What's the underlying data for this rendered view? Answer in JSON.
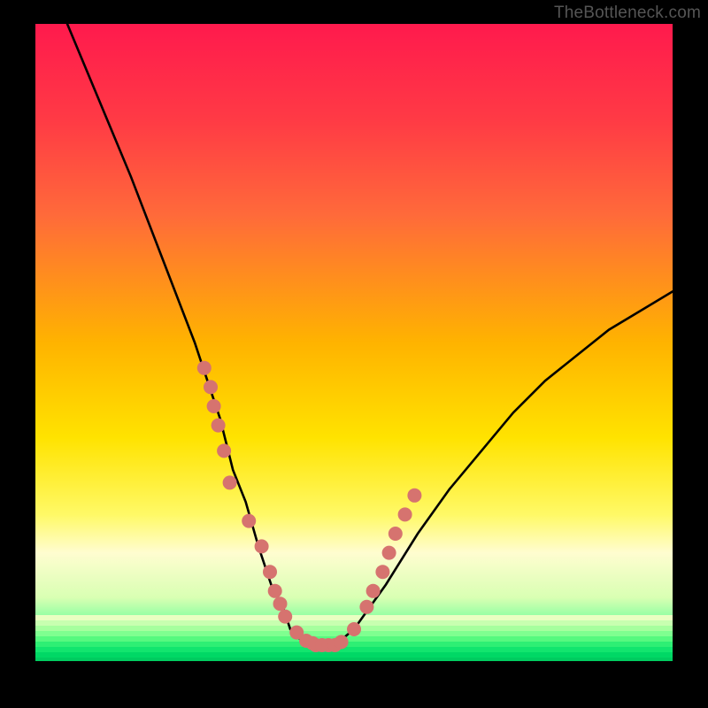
{
  "watermark": "TheBottleneck.com",
  "colors": {
    "background": "#000000",
    "curve": "#000000",
    "dot_fill": "#d6736f",
    "dot_stroke": "#b94f4c",
    "gradient_top": "#ff1a4d",
    "gradient_bottom": "#00d865"
  },
  "chart_data": {
    "type": "line",
    "title": "",
    "xlabel": "",
    "ylabel": "",
    "xlim": [
      0,
      100
    ],
    "ylim": [
      0,
      100
    ],
    "grid": false,
    "series": [
      {
        "name": "bottleneck-curve",
        "x": [
          5,
          10,
          15,
          20,
          25,
          26,
          27,
          28,
          29,
          30,
          31,
          33,
          35,
          37,
          39,
          40,
          41,
          42,
          43,
          44,
          45,
          46,
          47,
          50,
          55,
          60,
          65,
          70,
          75,
          80,
          85,
          90,
          95,
          100
        ],
        "y": [
          100,
          88,
          76,
          63,
          50,
          47,
          44,
          41,
          38,
          34,
          30,
          25,
          18,
          12,
          8,
          5,
          4,
          3,
          2.5,
          2.5,
          2,
          2,
          2.5,
          5,
          12,
          20,
          27,
          33,
          39,
          44,
          48,
          52,
          55,
          58
        ]
      }
    ],
    "markers": {
      "name": "highlight-dots",
      "x": [
        26.5,
        27.5,
        28.0,
        28.7,
        29.6,
        30.5,
        33.5,
        35.5,
        36.8,
        37.6,
        38.4,
        39.2,
        41.0,
        42.5,
        43.5,
        44.0,
        45.0,
        46.0,
        47.0,
        48.0,
        50.0,
        52.0,
        53.0,
        54.5,
        55.5,
        56.5,
        58.0,
        59.5
      ],
      "y": [
        46.0,
        43.0,
        40.0,
        37.0,
        33.0,
        28.0,
        22.0,
        18.0,
        14.0,
        11.0,
        9.0,
        7.0,
        4.5,
        3.2,
        2.8,
        2.5,
        2.5,
        2.5,
        2.5,
        3.0,
        5.0,
        8.5,
        11.0,
        14.0,
        17.0,
        20.0,
        23.0,
        26.0
      ]
    }
  }
}
